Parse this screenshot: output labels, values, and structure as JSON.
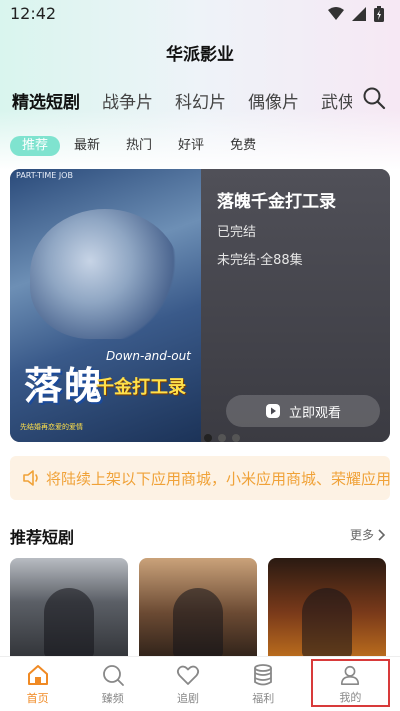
{
  "status": {
    "time": "12:42"
  },
  "app": {
    "title": "华派影业"
  },
  "tabs": [
    "精选短剧",
    "战争片",
    "科幻片",
    "偶像片",
    "武侠"
  ],
  "chips": [
    "推荐",
    "最新",
    "热门",
    "好评",
    "免费"
  ],
  "banner": {
    "poster_top": "PART-TIME JOB",
    "poster_title": "落魄",
    "poster_sub": "千金打工录",
    "poster_en": "Down-and-out",
    "poster_tag": "先结婚再恋爱的爱情",
    "title": "落魄千金打工录",
    "status": "已完结",
    "episodes": "未完结·全88集",
    "watch_label": "立即观看"
  },
  "notice": {
    "text": "将陆续上架以下应用商城，小米应用商城、荣耀应用商城"
  },
  "section": {
    "title": "推荐短剧",
    "more": "更多"
  },
  "tabbar": [
    "首页",
    "臻频",
    "追剧",
    "福利",
    "我的"
  ],
  "colors": {
    "accent": "#f08a24",
    "chip_active": "#7fe3cf",
    "notice_text": "#f0a238",
    "highlight_box": "#d83a3a"
  }
}
